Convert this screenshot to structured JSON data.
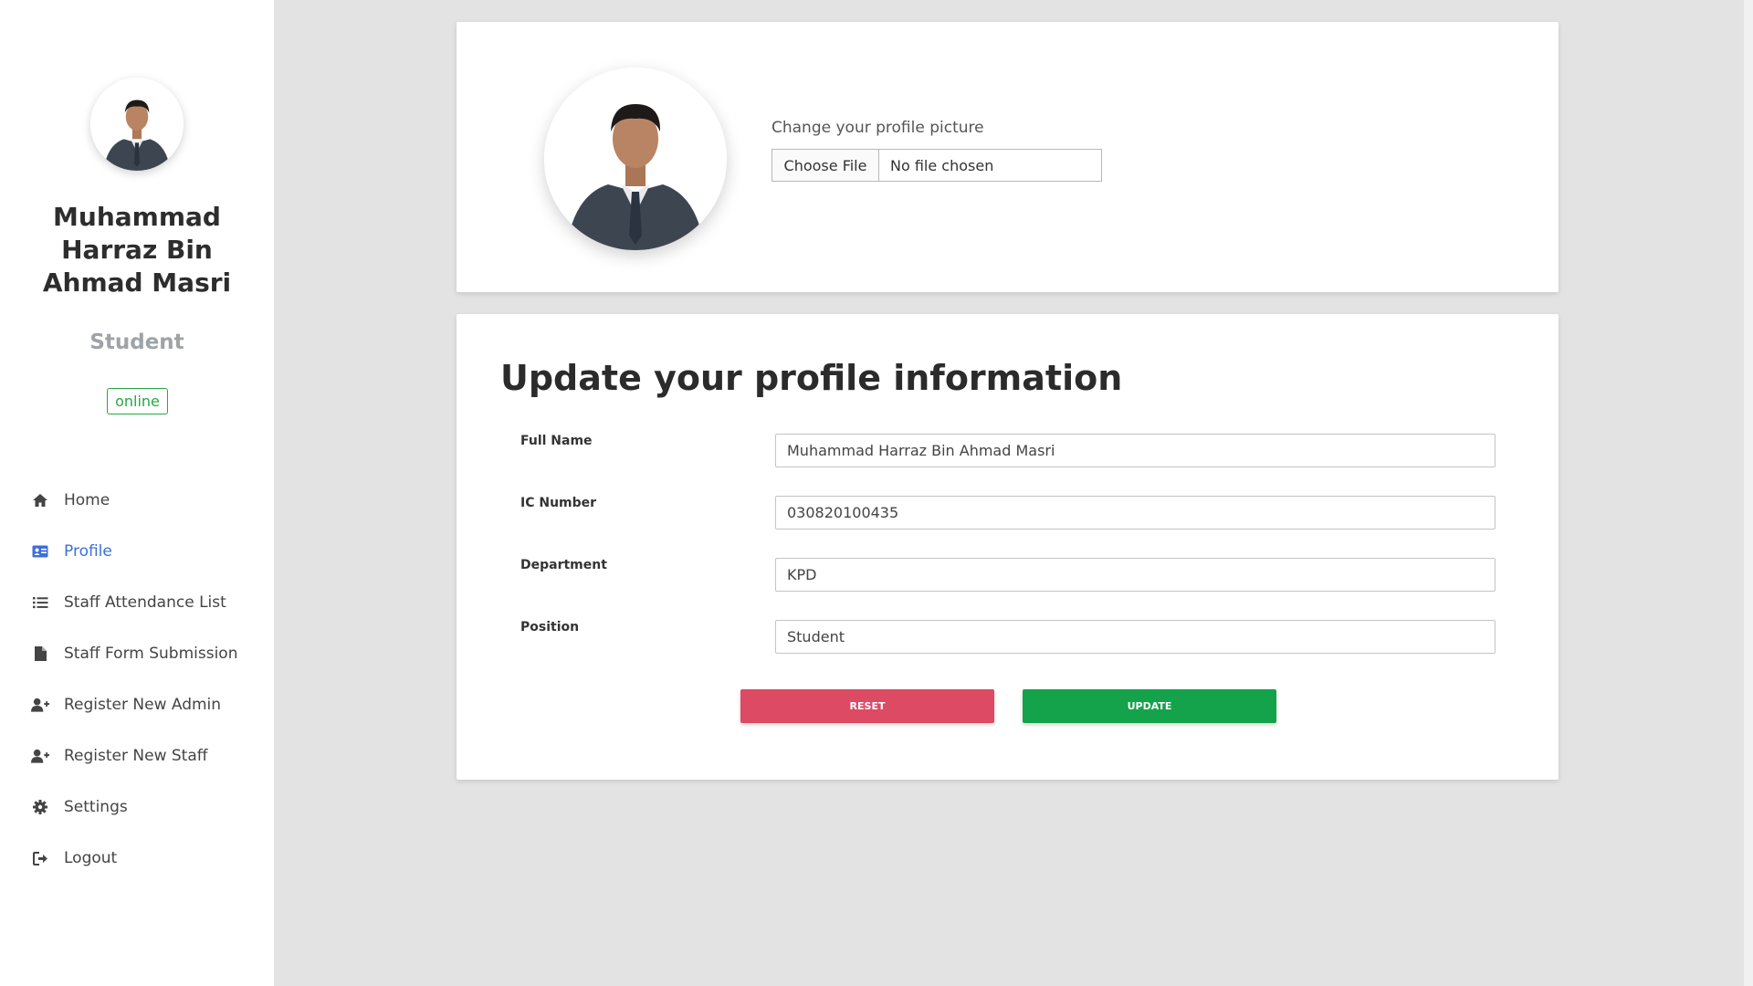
{
  "sidebar": {
    "user_name": "Muhammad Harraz Bin Ahmad Masri",
    "role": "Student",
    "status": "online",
    "nav": [
      {
        "label": "Home",
        "icon": "home-icon"
      },
      {
        "label": "Profile",
        "icon": "id-card-icon",
        "active": true
      },
      {
        "label": "Staff Attendance List",
        "icon": "list-icon"
      },
      {
        "label": "Staff Form Submission",
        "icon": "file-icon"
      },
      {
        "label": "Register New Admin",
        "icon": "user-plus-icon"
      },
      {
        "label": "Register New Staff",
        "icon": "user-plus-icon"
      },
      {
        "label": "Settings",
        "icon": "gear-icon"
      },
      {
        "label": "Logout",
        "icon": "sign-out-icon"
      }
    ]
  },
  "picture": {
    "label": "Change your profile picture",
    "button": "Choose File",
    "file_status": "No file chosen"
  },
  "form": {
    "title": "Update your profile information",
    "fields": [
      {
        "label": "Full Name",
        "value": "Muhammad Harraz Bin Ahmad Masri"
      },
      {
        "label": "IC Number",
        "value": "030820100435"
      },
      {
        "label": "Department",
        "value": "KPD"
      },
      {
        "label": "Position",
        "value": "Student"
      }
    ],
    "reset_label": "RESET",
    "update_label": "UPDATE"
  },
  "colors": {
    "accent": "#3e6fd8",
    "reset": "#dc4a63",
    "update": "#14a34a",
    "online": "#28a745"
  }
}
